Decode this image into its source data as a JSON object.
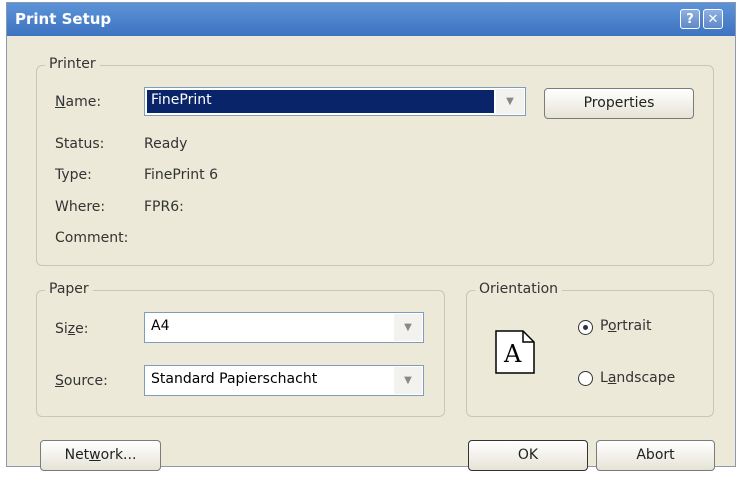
{
  "window": {
    "title": "Print Setup",
    "help_glyph": "?",
    "close_glyph": "✕"
  },
  "printer": {
    "legend": "Printer",
    "name_label": "Name:",
    "name_value": "FinePrint",
    "properties_label": "Properties",
    "status_label": "Status:",
    "status_value": "Ready",
    "type_label": "Type:",
    "type_value": "FinePrint 6",
    "where_label": "Where:",
    "where_value": "FPR6:",
    "comment_label": "Comment:",
    "comment_value": ""
  },
  "paper": {
    "legend": "Paper",
    "size_label": "Size:",
    "size_value": "A4",
    "source_label": "Source:",
    "source_value": "Standard Papierschacht"
  },
  "orientation": {
    "legend": "Orientation",
    "page_letter": "A",
    "portrait_label": "Portrait",
    "landscape_label": "Landscape",
    "selected": "portrait"
  },
  "buttons": {
    "network_label": "Network...",
    "ok_label": "OK",
    "abort_label": "Abort"
  }
}
